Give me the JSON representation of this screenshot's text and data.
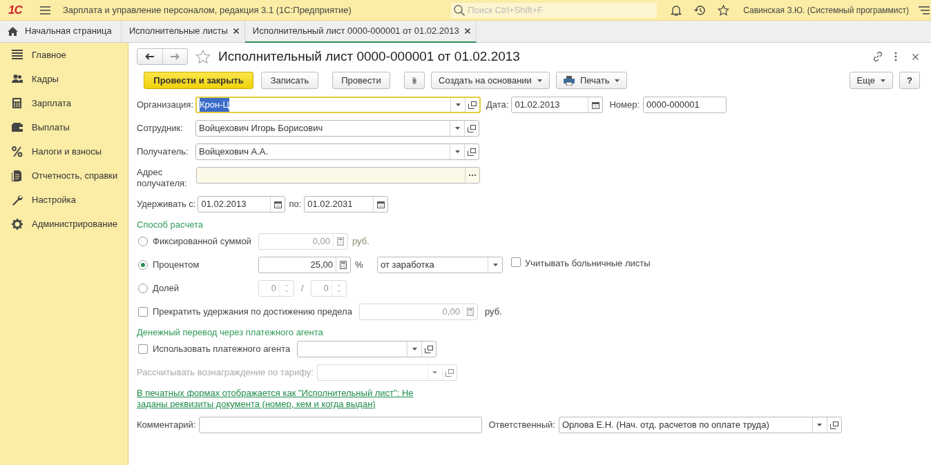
{
  "app": {
    "logo": "1С",
    "title": "Зарплата и управление персоналом, редакция 3.1 (1С:Предприятие)",
    "search": {
      "placeholder": "Поиск Ctrl+Shift+F"
    },
    "user": "Савинская З.Ю. (Системный программист)"
  },
  "tabs": [
    {
      "label": "Начальная страница",
      "kind": "home",
      "selected": false
    },
    {
      "label": "Исполнительные листы",
      "kind": "document",
      "selected": false
    },
    {
      "label": "Исполнительный лист 0000-000001 от 01.02.2013",
      "kind": "document",
      "selected": true
    }
  ],
  "sidebar": {
    "items": [
      {
        "label": "Главное"
      },
      {
        "label": "Кадры"
      },
      {
        "label": "Зарплата"
      },
      {
        "label": "Выплаты"
      },
      {
        "label": "Налоги и взносы"
      },
      {
        "label": "Отчетность, справки"
      },
      {
        "label": "Настройка"
      },
      {
        "label": "Администрирование"
      }
    ]
  },
  "document": {
    "title": "Исполнительный лист 0000-000001 от 01.02.2013",
    "toolbar": [
      {
        "kind": "primary",
        "label": "Провести и закрыть"
      },
      {
        "kind": "plain",
        "label": "Записать"
      },
      {
        "kind": "plain",
        "label": "Провести"
      },
      {
        "kind": "attach"
      },
      {
        "kind": "menu",
        "label": "Создать на основании"
      },
      {
        "kind": "print",
        "label": "Печать"
      }
    ],
    "toolbar_right": [
      {
        "kind": "menu",
        "label": "Еще"
      },
      {
        "kind": "plain",
        "label": "?"
      }
    ],
    "organization": {
      "label": "Организация:",
      "value": "Крон-Ц",
      "focused": true
    },
    "date": {
      "label": "Дата:",
      "value": "01.02.2013"
    },
    "number": {
      "label": "Номер:",
      "value": "0000-000001"
    },
    "employee": {
      "label": "Сотрудник:",
      "value": "Войцехович Игорь Борисович"
    },
    "recipient": {
      "label": "Получатель:",
      "value": "Войцехович А.А."
    },
    "recipient_address": {
      "label": "Адрес получателя:"
    },
    "withhold": {
      "label": "Удерживать с:",
      "from": "01.02.2013",
      "to_label": "по:",
      "to": "01.02.2031"
    },
    "calculation": {
      "title": "Способ расчета",
      "options": [
        {
          "kind": "fixed",
          "label": "Фиксированной суммой",
          "selected": false,
          "value": "0,00",
          "unit": "руб."
        },
        {
          "kind": "percent",
          "label": "Процентом",
          "selected": true,
          "value": "25,00",
          "unit": "%",
          "base": "от заработка",
          "sick_leave": {
            "label": "Учитывать больничные листы",
            "checked": false
          }
        },
        {
          "kind": "share",
          "label": "Долей",
          "selected": false,
          "numerator": "0",
          "separator": "/",
          "denominator": "0"
        }
      ]
    },
    "limit": {
      "label": "Прекратить удержания по достижению предела",
      "checked": false,
      "value": "0,00",
      "unit": "руб."
    },
    "payment_agent": {
      "title": "Денежный перевод через платежного агента",
      "use_agent": {
        "label": "Использовать платежного агента",
        "checked": false
      },
      "tariff_label": "Рассчитывать вознаграждение по тарифу:"
    },
    "notice_link": "В печатных формах отображается как \"Исполнительный лист\": Не заданы реквизиты документа (номер, кем и когда выдан)",
    "comment": {
      "label": "Комментарий:"
    },
    "responsible": {
      "label": "Ответственный:",
      "value": "Орлова Е.Н. (Нач. отд. расчетов по оплате труда)"
    }
  }
}
